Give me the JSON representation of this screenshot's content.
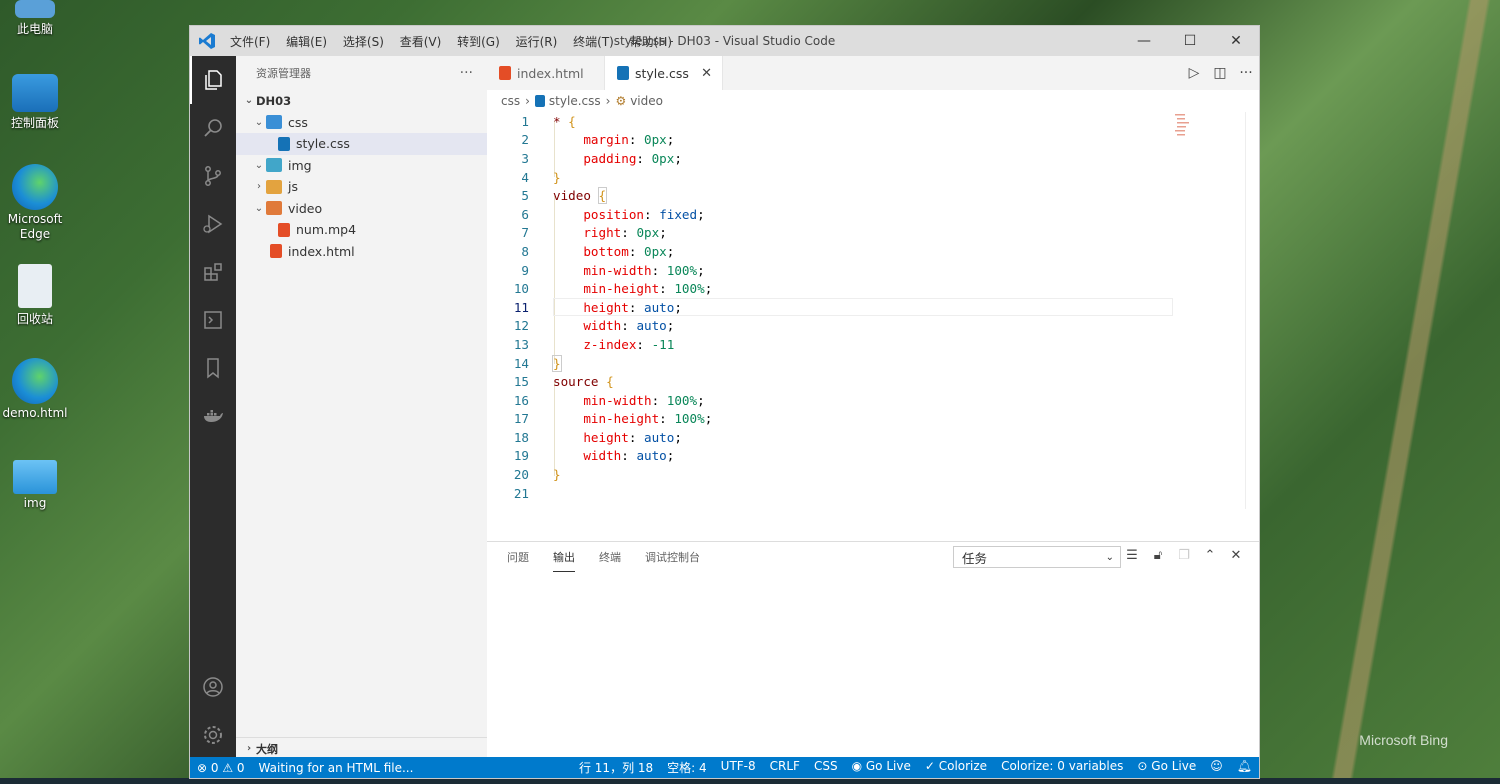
{
  "desktop": {
    "icons": [
      {
        "label": "此电脑"
      },
      {
        "label": "控制面板"
      },
      {
        "label": "Microsoft Edge"
      },
      {
        "label": "回收站"
      },
      {
        "label": "demo.html"
      },
      {
        "label": "img"
      }
    ],
    "watermark": "Microsoft Bing"
  },
  "window": {
    "title": "style.css - DH03 - Visual Studio Code",
    "menu": [
      "文件(F)",
      "编辑(E)",
      "选择(S)",
      "查看(V)",
      "转到(G)",
      "运行(R)",
      "终端(T)",
      "帮助(H)"
    ],
    "controls": {
      "minimize": "—",
      "maximize": "☐",
      "close": "✕"
    }
  },
  "sidebar": {
    "header": "资源管理器",
    "more": "···",
    "root": "DH03",
    "tree": [
      {
        "label": "css",
        "type": "folder"
      },
      {
        "label": "style.css",
        "type": "css"
      },
      {
        "label": "img",
        "type": "folder"
      },
      {
        "label": "js",
        "type": "folder"
      },
      {
        "label": "video",
        "type": "folder"
      },
      {
        "label": "num.mp4",
        "type": "file"
      },
      {
        "label": "index.html",
        "type": "html"
      }
    ],
    "outline": "大纲"
  },
  "tabs": [
    {
      "label": "index.html"
    },
    {
      "label": "style.css",
      "close": "✕"
    }
  ],
  "breadcrumb": {
    "folder": "css",
    "file": "style.css",
    "symbol": "video"
  },
  "code": {
    "current_line": 11,
    "lines": [
      {
        "n": "1"
      },
      {
        "n": "2"
      },
      {
        "n": "3"
      },
      {
        "n": "4"
      },
      {
        "n": "5"
      },
      {
        "n": "6"
      },
      {
        "n": "7"
      },
      {
        "n": "8"
      },
      {
        "n": "9"
      },
      {
        "n": "10"
      },
      {
        "n": "11"
      },
      {
        "n": "12"
      },
      {
        "n": "13"
      },
      {
        "n": "14"
      },
      {
        "n": "15"
      },
      {
        "n": "16"
      },
      {
        "n": "17"
      },
      {
        "n": "18"
      },
      {
        "n": "19"
      },
      {
        "n": "20"
      },
      {
        "n": "21"
      }
    ],
    "text": {
      "l1_sel": "* ",
      "l1_b": "{",
      "l2_p": "margin",
      "l2_v": "0px",
      "l3_p": "padding",
      "l3_v": "0px",
      "l4_b": "}",
      "l5_sel": "video ",
      "l5_b": "{",
      "l6_p": "position",
      "l6_v": "fixed",
      "l7_p": "right",
      "l7_v": "0px",
      "l8_p": "bottom",
      "l8_v": "0px",
      "l9_p": "min-width",
      "l9_v": "100%",
      "l10_p": "min-height",
      "l10_v": "100%",
      "l11_p": "height",
      "l11_v": "auto",
      "l12_p": "width",
      "l12_v": "auto",
      "l13_p": "z-index",
      "l13_v": "-11",
      "l14_b": "}",
      "l15_sel": "source ",
      "l15_b": "{",
      "l16_p": "min-width",
      "l16_v": "100%",
      "l17_p": "min-height",
      "l17_v": "100%",
      "l18_p": "height",
      "l18_v": "auto",
      "l19_p": "width",
      "l19_v": "auto",
      "l20_b": "}"
    }
  },
  "panel": {
    "tabs": [
      "问题",
      "输出",
      "终端",
      "调试控制台"
    ],
    "active_tab": "输出",
    "select_value": "任务"
  },
  "statusbar": {
    "errors": "0",
    "warnings": "0",
    "message": "Waiting for an HTML file...",
    "position": "行 11，列 18",
    "spaces": "空格: 4",
    "encoding": "UTF-8",
    "eol": "CRLF",
    "language": "CSS",
    "golive1": "Go Live",
    "colorize": "Colorize",
    "colorize_vars": "Colorize: 0 variables",
    "golive2": "Go Live"
  },
  "colors": {
    "statusbar": "#007acc",
    "activitybar": "#2c2c2c",
    "sidebar": "#f3f3f3",
    "html_icon": "#e44d26",
    "css_icon": "#1572b6"
  }
}
